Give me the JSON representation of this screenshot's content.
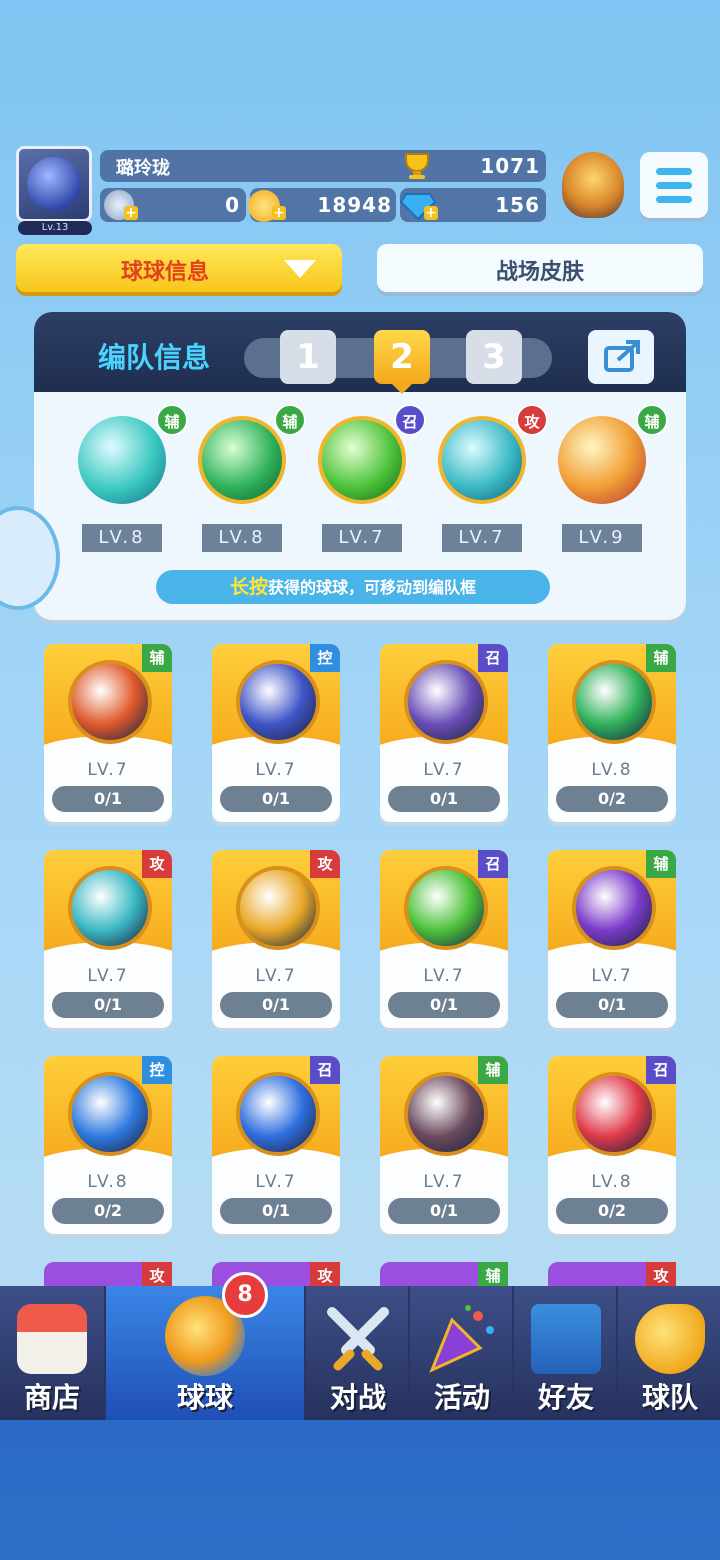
{
  "player": {
    "name": "璐玲珑",
    "avatar_level": "Lv.13",
    "trophies": "1071",
    "resource_1": "0",
    "coins": "18948",
    "diamonds": "156"
  },
  "tabs": {
    "ball_info": "球球信息",
    "battle_skin": "战场皮肤"
  },
  "team": {
    "title": "编队信息",
    "slots": [
      "1",
      "2",
      "3"
    ],
    "active_slot": "2",
    "balls": [
      {
        "level": "LV.8",
        "role": "辅",
        "role_color": "#3aa845",
        "color": "#39c7c0"
      },
      {
        "level": "LV.8",
        "role": "辅",
        "role_color": "#3aa845",
        "color": "#2fb15a"
      },
      {
        "level": "LV.7",
        "role": "召",
        "role_color": "#5a4dc9",
        "color": "#4dc23a"
      },
      {
        "level": "LV.7",
        "role": "攻",
        "role_color": "#d83b3b",
        "color": "#3ab9c4"
      },
      {
        "level": "LV.9",
        "role": "辅",
        "role_color": "#3aa845",
        "color": "#f2a23a"
      }
    ],
    "hint_highlight": "长按",
    "hint_text": "获得的球球，可移动到编队框"
  },
  "cards": [
    {
      "level": "LV.7",
      "progress": "0/1",
      "tag": "辅",
      "tag_color": "#3aa845",
      "ball_color": "#e0592b"
    },
    {
      "level": "LV.7",
      "progress": "0/1",
      "tag": "控",
      "tag_color": "#2f8ee0",
      "ball_color": "#3f55c8"
    },
    {
      "level": "LV.7",
      "progress": "0/1",
      "tag": "召",
      "tag_color": "#5a4dc9",
      "ball_color": "#6a4fb6"
    },
    {
      "level": "LV.8",
      "progress": "0/2",
      "tag": "辅",
      "tag_color": "#3aa845",
      "ball_color": "#2fb15a"
    },
    {
      "level": "LV.7",
      "progress": "0/1",
      "tag": "攻",
      "tag_color": "#d83b3b",
      "ball_color": "#3ab9c4"
    },
    {
      "level": "LV.7",
      "progress": "0/1",
      "tag": "攻",
      "tag_color": "#d83b3b",
      "ball_color": "#e8a928"
    },
    {
      "level": "LV.7",
      "progress": "0/1",
      "tag": "召",
      "tag_color": "#5a4dc9",
      "ball_color": "#4dc23a"
    },
    {
      "level": "LV.7",
      "progress": "0/1",
      "tag": "辅",
      "tag_color": "#3aa845",
      "ball_color": "#7b3bc9"
    },
    {
      "level": "LV.8",
      "progress": "0/2",
      "tag": "控",
      "tag_color": "#2f8ee0",
      "ball_color": "#2f7be0"
    },
    {
      "level": "LV.7",
      "progress": "0/1",
      "tag": "召",
      "tag_color": "#5a4dc9",
      "ball_color": "#2f6fe0"
    },
    {
      "level": "LV.7",
      "progress": "0/1",
      "tag": "辅",
      "tag_color": "#3aa845",
      "ball_color": "#6b4a5e"
    },
    {
      "level": "LV.8",
      "progress": "0/2",
      "tag": "召",
      "tag_color": "#5a4dc9",
      "ball_color": "#e03a4a"
    }
  ],
  "peek_tags": [
    {
      "tag": "攻",
      "tag_color": "#d83b3b"
    },
    {
      "tag": "攻",
      "tag_color": "#d83b3b"
    },
    {
      "tag": "辅",
      "tag_color": "#3aa845"
    },
    {
      "tag": "攻",
      "tag_color": "#d83b3b"
    }
  ],
  "nav": {
    "shop": "商店",
    "balls": "球球",
    "battle": "对战",
    "events": "活动",
    "friends": "好友",
    "team": "球队",
    "balls_badge": "8"
  }
}
